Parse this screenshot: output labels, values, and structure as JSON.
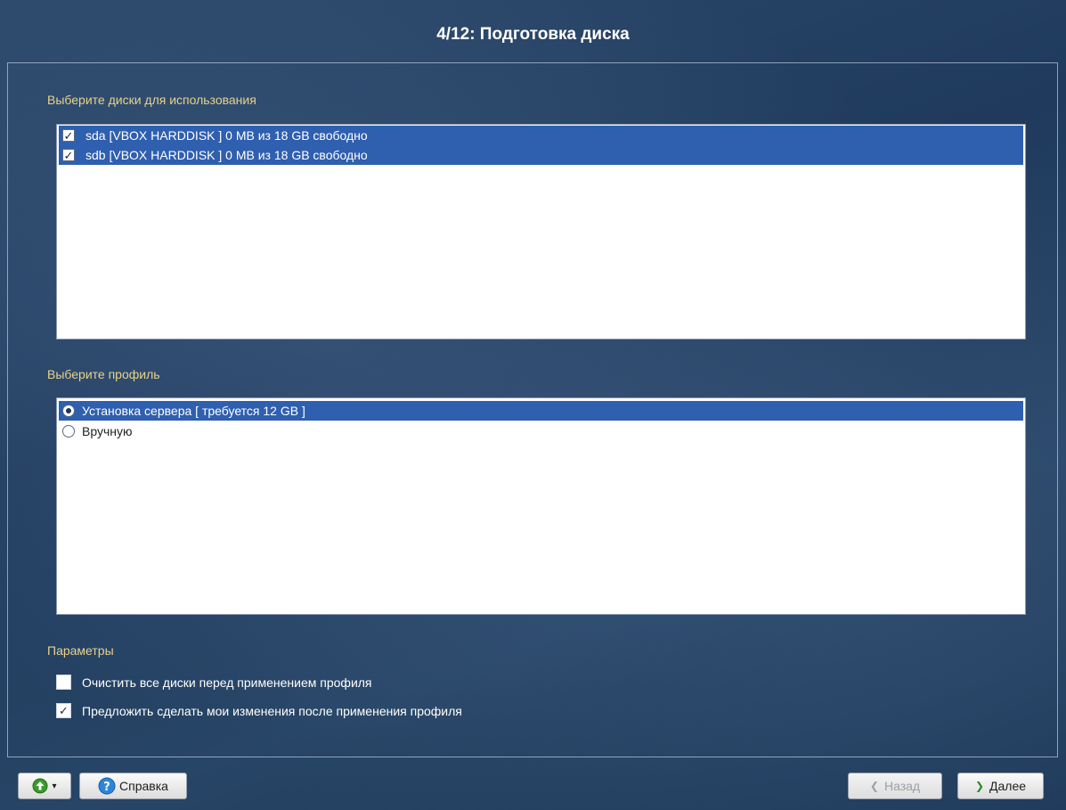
{
  "window": {
    "title": "4/12: Подготовка диска"
  },
  "disks": {
    "label": "Выберите диски для использования",
    "items": [
      {
        "label": "sda [VBOX HARDDISK   ] 0 MB из 18 GB свободно",
        "checked": true
      },
      {
        "label": "sdb [VBOX HARDDISK   ] 0 MB из 18 GB свободно",
        "checked": true
      }
    ]
  },
  "profile": {
    "label": "Выберите профиль",
    "items": [
      {
        "label": "Установка сервера [ требуется 12 GB ]",
        "selected": true
      },
      {
        "label": "Вручную",
        "selected": false
      }
    ]
  },
  "params": {
    "label": "Параметры",
    "options": [
      {
        "label": "Очистить все диски перед применением профиля",
        "checked": false
      },
      {
        "label": "Предложить сделать мои изменения после применения профиля",
        "checked": true
      }
    ]
  },
  "footer": {
    "menu_icon": "green-circle-arrow-icon",
    "help_label": "Справка",
    "back_label": "Назад",
    "next_label": "Далее"
  },
  "colors": {
    "section_label": "#e8d28a",
    "selection": "#2f5faf",
    "background": "#24415f"
  }
}
